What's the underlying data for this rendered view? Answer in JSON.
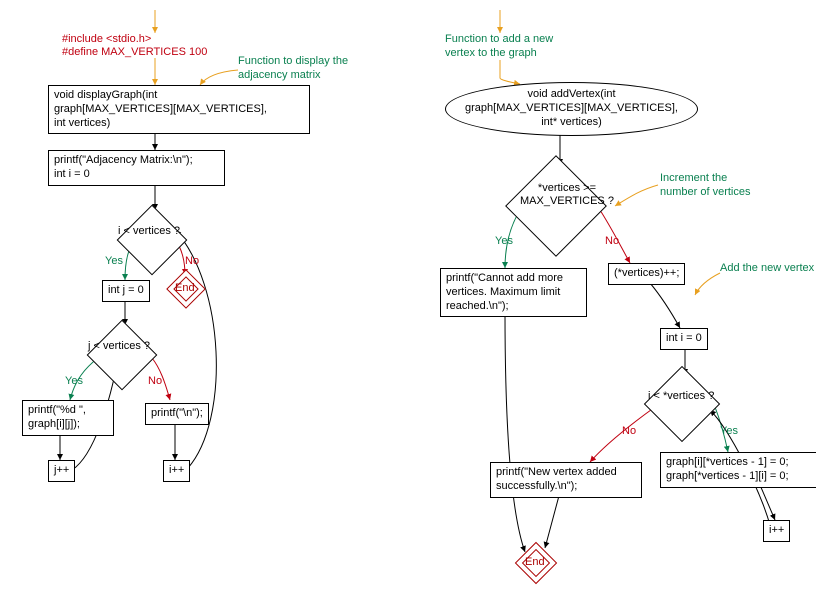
{
  "left": {
    "code1": "#include <stdio.h>",
    "code2": "#define MAX_VERTICES 100",
    "comment_func": "Function to display the\nadjacency matrix",
    "func_sig": "void displayGraph(int\ngraph[MAX_VERTICES][MAX_VERTICES],\nint vertices)",
    "stmt_init": "printf(\"Adjacency Matrix:\\n\");\nint i = 0",
    "cond_i": "i < vertices ?",
    "stmt_j0": "int j = 0",
    "cond_j": "j < vertices ?",
    "stmt_printcell": "printf(\"%d \",\ngraph[i][j]);",
    "stmt_jpp": "j++",
    "stmt_println": "printf(\"\\n\");",
    "stmt_ipp": "i++",
    "end": "End",
    "yes": "Yes",
    "no": "No"
  },
  "right": {
    "comment_func": "Function to add a new\nvertex to the graph",
    "func_sig": "void addVertex(int\ngraph[MAX_VERTICES][MAX_VERTICES],\nint* vertices)",
    "cond_max": "*vertices >=\nMAX_VERTICES ?",
    "comment_inc": "Increment the\nnumber of vertices",
    "stmt_cannot": "printf(\"Cannot add more\nvertices. Maximum limit\nreached.\\n\");",
    "stmt_vpp": "(*vertices)++;",
    "comment_add": "Add the new vertex",
    "stmt_i0": "int i = 0",
    "cond_i": "i < *vertices ?",
    "stmt_success": "printf(\"New vertex added\nsuccessfully.\\n\");",
    "stmt_zero": "graph[i][*vertices - 1] = 0;\ngraph[*vertices - 1][i] = 0;",
    "stmt_ipp": "i++",
    "end": "End",
    "yes": "Yes",
    "no": "No"
  }
}
